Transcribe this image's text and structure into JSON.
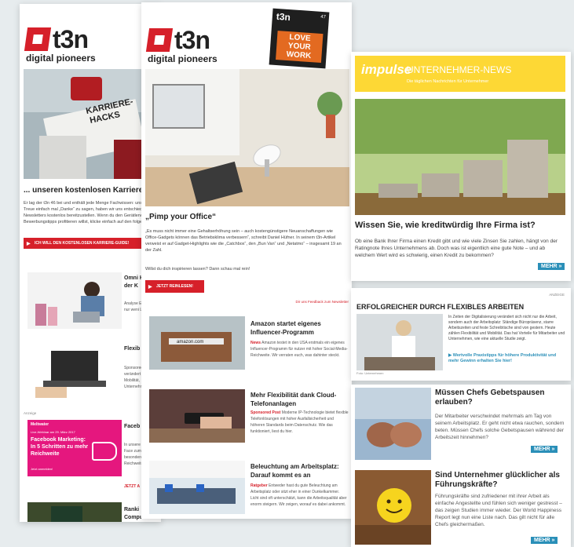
{
  "left": {
    "logo_text": "t3n",
    "logo_sub": "digital pioneers",
    "hero_title": "... unseren kostenlosen Karriere-",
    "hero_body": "Er lag der t3n 46 bei und enthält jede Menge Fachwissen: unsere Treue einfach mal „Danke“ zu sagen, haben wir uns entschieden, Newsletters kostenlos bereitzustellen. Wenn du den Gerätlerver Bewerbungstipps profitieren willst, klicke einfach auf den folgen",
    "cta": "ICH WILL DEN KOSTENLOSEN KARRIERE-GUIDE!",
    "articles": [
      {
        "title": "Omni Händl der K",
        "text": "Analyse Einkauf, s nur weni Leser, wi"
      },
      {
        "title": "Flexib Feindl",
        "text": "Sponsored verändert der Arbeit Mobilität, Unternehm"
      },
      {
        "title": "Faceb Schrit",
        "text": "In unsere Dein Face zum Erfo besondere Reichweite"
      },
      {
        "title": "Ranki Compu",
        "text": ""
      }
    ],
    "anzeige": "Anzeige",
    "meltwater": "Meltwater",
    "webinar": "Live-Webinar am 29. März 2017",
    "fb_title": "Facebook Marketing: In 5 Schritten zu mehr Reichweite",
    "fb_btn": "Jetzt anmelden!",
    "jetzt": "JETZT A"
  },
  "middle": {
    "logo_text": "t3n",
    "logo_sub": "digital pioneers",
    "hero_title": "„Pimp your Office“",
    "hero_body": "„Es muss nicht immer eine Gehaltserhöhung sein – auch kostengünstigere Neuanschaffungen wie Office-Gadgets können das Betriebsklima verbessern“, schreibt Daniel Hüfner. In seinem t3n-Artikel verweist er auf Gadget-Highlights wie die „Catchbox“, den „Bun Van“ und „Netatmo“ – insgesamt 19 an der Zahl.",
    "hero_body2": "Willst du dich inspirieren lassen? Dann schau mal rein!",
    "cta": "JETZT REINLESEN!",
    "feedback": "Dir uns Feedback zum Newsletter",
    "magazine_top": "t3n",
    "magazine_words": "LOVE YOUR WORK",
    "magazine_num": "47",
    "articles": [
      {
        "title": "Amazon startet eigenes Influencer-Programm",
        "tag": "News",
        "text": " Amazon testet in den USA erstmals ein eigenes Influencer-Programm für nutzer mit hoher Social-Media-Reichweite. Wir verraten euch, was dahinter steckt."
      },
      {
        "title": "Mehr Flexibilität dank Cloud-Telefonanlagen",
        "tag": "Sponsored Post",
        "text": " Moderne IP-Technologie bietet flexible Telefonlösungen mit hoher Ausfallsicherheit und höheren Standards beim Datenschutz. Wie das funktioniert, liest du hier."
      },
      {
        "title": "Beleuchtung am Arbeitsplatz: Darauf kommt es an",
        "tag": "Ratgeber",
        "text": " Entweder hast du gute Beleuchtung am Arbeitsplatz oder sitzt eher in einer Dunkelkammer. Licht sind oft unterschätzt, kann die Arbeitsqualität aber enorm steigern. Wir zeigen, worauf es dabei ankommt."
      }
    ]
  },
  "right": {
    "brand": "impulse",
    "brand_sub": "UNTERNEHMER-NEWS",
    "brand_tagline": "Die täglichen Nachrichten für Unternehmer",
    "hero_title": "Wissen Sie, wie kreditwürdig Ihre Firma ist?",
    "hero_body": "Ob eine Bank Ihrer Firma einen Kredit gibt und wie viele Zinsen Sie zahlen, hängt von der Ratingnote Ihres Unternehmens ab. Doch was ist eigentlich eine gute Note – und ab welchem Wert wird es schwierig, einen Kredit zu bekommen?",
    "mehr": "MEHR »",
    "anzeige": "ANZEIGE",
    "ad_title": "ERFOLGREICHER DURCH FLEXIBLES ARBEITEN",
    "ad_body": "In Zeiten der Digitalisierung verändert sich nicht nur die Arbeit, sondern auch der Arbeitsplatz: Ständige Büropräsenz, starre Arbeitszeiten und feste Schreibtische sind von gestern. Heute zählen Flexibilität und Mobilität. Das hat Vorteile für Mitarbeiter und Unternehmen, wie eine aktuelle Studie zeigt.",
    "ad_link": "Wertvolle Praxistipps für höhere Produktivität und mehr Gewinn erhalten Sie hier!",
    "ad_caption": "Foto: Unternehmen",
    "articles": [
      {
        "title": "Müssen Chefs Gebetspausen erlauben?",
        "text": "Der Mitarbeiter verschwindet mehrmals am Tag von seinem Arbeitsplatz. Er geht nicht etwa rauchen, sondern beten. Müssen Chefs solche Gebetspausen während der Arbeitszeit hinnehmen?",
        "mehr": "MEHR »"
      },
      {
        "title": "Sind Unternehmer glücklicher als Führungskräfte?",
        "text": "Führungskräfte sind zufriedener mit ihrer Arbeit als einfache Angestellte und fühlen sich weniger gestresst – das zeigen Studien immer wieder. Der World Happiness Report legt nun eine Liste nach. Das gilt nicht für alle Chefs gleichermaßen.",
        "mehr": "MEHR »"
      }
    ]
  },
  "colors": {
    "t3n_red": "#d6202a",
    "impulse_yellow": "#fdd835",
    "impulse_blue": "#2a8fb8",
    "facebook_pink": "#e5177e"
  }
}
